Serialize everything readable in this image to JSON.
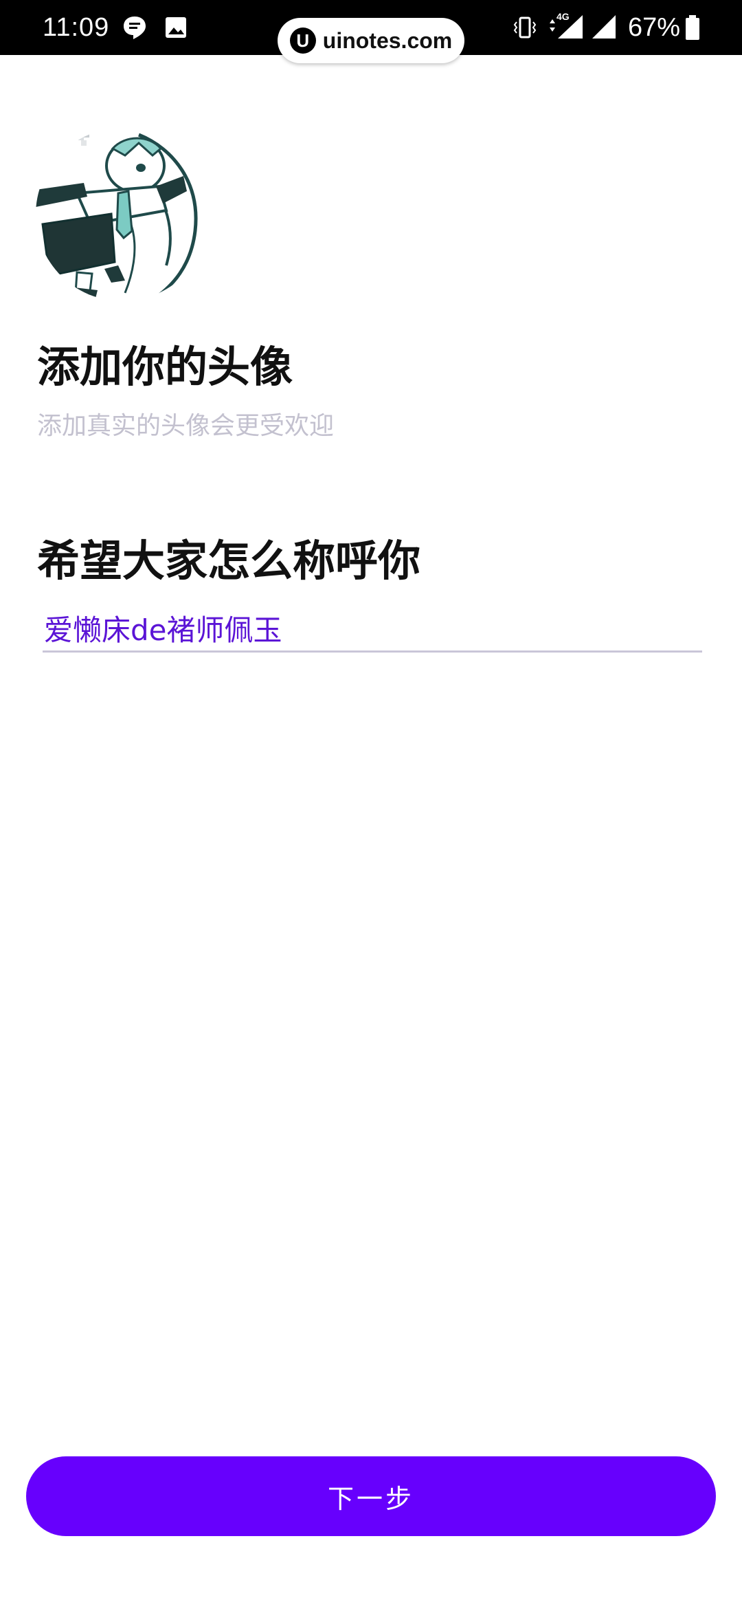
{
  "status_bar": {
    "time": "11:09",
    "network": "4G",
    "battery": "67%",
    "icons": [
      "message-bubble-icon",
      "image-icon",
      "vibrate-icon",
      "signal-4g-icon",
      "signal-icon",
      "battery-icon"
    ]
  },
  "watermark": {
    "logo": "U",
    "text": "uinotes.com"
  },
  "avatar": {
    "description_icon": "avatar-image"
  },
  "avatar_section": {
    "title": "添加你的头像",
    "hint": "添加真实的头像会更受欢迎"
  },
  "nickname_section": {
    "title": "希望大家怎么称呼你",
    "value": "爱懒床de褚师佩玉"
  },
  "footer": {
    "next_label": "下一步"
  },
  "colors": {
    "accent": "#6700fd",
    "input_text": "#5b14d6",
    "hint_text": "#c3c1cf",
    "underline": "#c9c6d8"
  }
}
